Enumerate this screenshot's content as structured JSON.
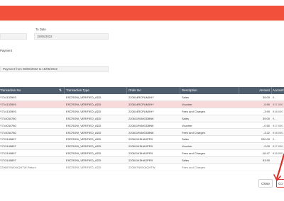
{
  "header": {
    "color": "#f2503b"
  },
  "filters": {
    "to_date_label": "To Date",
    "to_date_value": "15/06/2022",
    "payment_label": "Payment",
    "payment_value": "Payment from 08/06/2022 to 15/06/2022"
  },
  "table": {
    "columns": [
      "Transaction No",
      "Transaction Type",
      "Order No",
      "Description",
      "Amount",
      "Account"
    ],
    "rows": [
      {
        "txn": "Y714133993",
        "type": "ESCROW_VERIFIED_ADD",
        "order": "220614RCPUM0HY",
        "desc": "Sales",
        "amount": "39.00",
        "account": "9...",
        "highlight": false
      },
      {
        "txn": "Y714133993",
        "type": "ESCROW_VERIFIED_ADD",
        "order": "220614RCPUM0HY",
        "desc": "Voucher",
        "amount": "-0.90",
        "account": "917.000",
        "highlight": true
      },
      {
        "txn": "Y714133993",
        "type": "ESCROW_VERIFIED_ADD",
        "order": "220614RCPUM0HY",
        "desc": "Fees and Charges",
        "amount": "-3.90",
        "account": "918.000",
        "highlight": false
      },
      {
        "txn": "Y714034780",
        "type": "ESCROW_VERIFIED_ADD",
        "order": "220611R4MGDBNK",
        "desc": "Sales",
        "amount": "39.00",
        "account": "9...",
        "highlight": false
      },
      {
        "txn": "Y714034780",
        "type": "ESCROW_VERIFIED_ADD",
        "order": "220611R4MGDBNK",
        "desc": "Voucher",
        "amount": "-0.50",
        "account": "917.000",
        "highlight": false
      },
      {
        "txn": "Y714034780",
        "type": "ESCROW_VERIFIED_ADD",
        "order": "220611R4MGDBNK",
        "desc": "Fees and Charges",
        "amount": "-3.22",
        "account": "918.000",
        "highlight": false
      },
      {
        "txn": "Y713140897",
        "type": "ESCROW_VERIFIED_ADD",
        "order": "220611K5HAXPRX",
        "desc": "Sales",
        "amount": "200.00",
        "account": "9...",
        "highlight": false
      },
      {
        "txn": "Y713140897",
        "type": "ESCROW_VERIFIED_ADD",
        "order": "220611K5HAXPRX",
        "desc": "Voucher",
        "amount": "-2.00",
        "account": "917.000",
        "highlight": false
      },
      {
        "txn": "Y713140897",
        "type": "ESCROW_VERIFIED_ADD",
        "order": "220611K5HAXPRX",
        "desc": "Fees and Charges",
        "amount": "-16.47",
        "account": "918.000",
        "highlight": false
      },
      {
        "txn": "Y713140897",
        "type": "ESCROW_VERIFIED_ADD",
        "order": "220611K5HAXPRX",
        "desc": "Sales",
        "amount": "63.90",
        "account": "",
        "highlight": false
      },
      {
        "txn": "220607NWXAQHTW-Return",
        "type": "ESCROW_VERIFIED_ADD",
        "order": "220607NWXAQHTW",
        "desc": "Fees and Charges",
        "amount": "",
        "account": "",
        "highlight": false
      }
    ]
  },
  "footer": {
    "close_label": "Close",
    "confirm_label": "Co"
  },
  "annotation": {
    "arrow_color": "#d9302a"
  }
}
